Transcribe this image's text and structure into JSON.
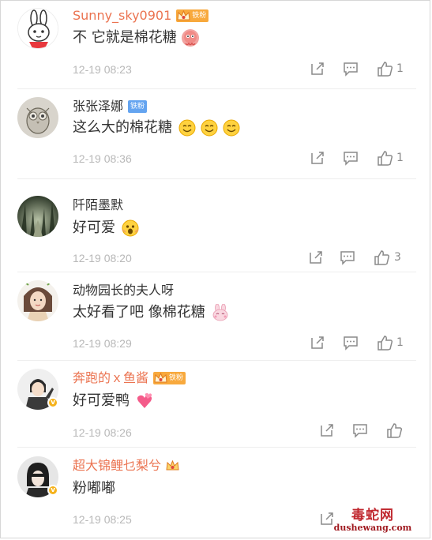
{
  "comments": [
    {
      "username": "Sunny_sky0901",
      "name_style": "vip",
      "badge": "铁粉",
      "text": "不 它就是棉花糖",
      "emojis": [
        "octopus-emoji"
      ],
      "time": "12-19 08:23",
      "likes": "1"
    },
    {
      "username": "张张泽娜",
      "name_style": "plain",
      "badge": "铁粉",
      "text": "这么大的棉花糖",
      "emojis": [
        "smile-emoji",
        "smile-emoji",
        "smile-emoji"
      ],
      "time": "12-19 08:36",
      "likes": "1"
    },
    {
      "username": "阡陌墨默",
      "name_style": "plain",
      "text": "好可爱",
      "emojis": [
        "scream-emoji"
      ],
      "time": "12-19 08:20",
      "likes": "3"
    },
    {
      "username": "动物园长的夫人呀",
      "name_style": "plain",
      "text": "太好看了吧 像棉花糖",
      "emojis": [
        "bunny-emoji"
      ],
      "time": "12-19 08:29",
      "likes": "1"
    },
    {
      "username": "奔跑的ｘ鱼酱",
      "name_style": "vip",
      "badge": "铁粉",
      "text": "好可爱鸭",
      "emojis": [
        "hearts-emoji"
      ],
      "time": "12-19 08:26",
      "likes": ""
    },
    {
      "username": "超大锦鲤乜梨兮",
      "name_style": "vip",
      "text": "粉嘟嘟",
      "time": "12-19 08:25",
      "likes": ""
    }
  ],
  "watermark": {
    "top": "毒蛇网",
    "bottom": "dushewang.com"
  },
  "colors": {
    "vip_name": "#eb7350",
    "plain_name": "#333333",
    "time": "#b8b8b8",
    "icon": "#8a8a8a"
  }
}
